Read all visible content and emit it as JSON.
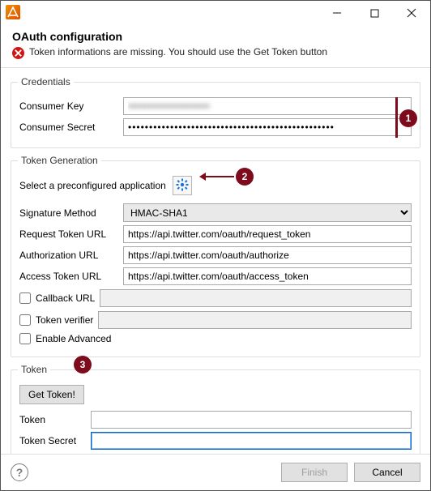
{
  "window": {
    "title": "OAuth configuration"
  },
  "error": {
    "message": "Token informations are missing. You should use the Get Token button"
  },
  "credentials": {
    "legend": "Credentials",
    "consumer_key_label": "Consumer Key",
    "consumer_key_value": "••••••••••••••••••••••••",
    "consumer_secret_label": "Consumer Secret",
    "consumer_secret_value": "•••••••••••••••••••••••••••••••••••••••••••••••••"
  },
  "token_gen": {
    "legend": "Token Generation",
    "preconfig_label": "Select a preconfigured application",
    "signature_method_label": "Signature Method",
    "signature_method_value": "HMAC-SHA1",
    "request_url_label": "Request Token URL",
    "request_url_value": "https://api.twitter.com/oauth/request_token",
    "auth_url_label": "Authorization URL",
    "auth_url_value": "https://api.twitter.com/oauth/authorize",
    "access_url_label": "Access Token URL",
    "access_url_value": "https://api.twitter.com/oauth/access_token",
    "callback_label": "Callback URL",
    "verifier_label": "Token verifier",
    "advanced_label": "Enable Advanced"
  },
  "token": {
    "legend": "Token",
    "get_token_label": "Get Token!",
    "token_label": "Token",
    "token_value": "",
    "secret_label": "Token Secret",
    "secret_value": ""
  },
  "footer": {
    "finish_label": "Finish",
    "cancel_label": "Cancel"
  },
  "annotations": {
    "one": "1",
    "two": "2",
    "three": "3"
  }
}
